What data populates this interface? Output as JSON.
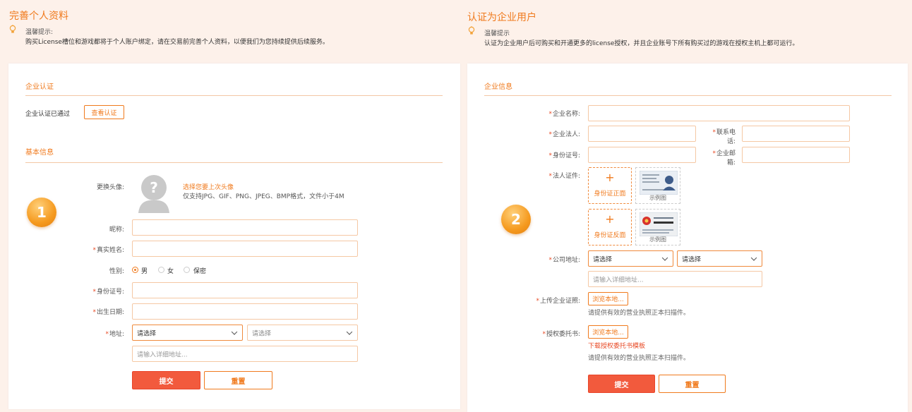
{
  "left": {
    "title": "完善个人资料",
    "tip_title": "温馨提示:",
    "tip_text": "购买License槽位和游戏都将于个人账户绑定，请在交易前完善个人资料，以便我们为您持续提供后续服务。",
    "enterprise_section": "企业认证",
    "enterprise_status": "企业认证已通过",
    "view_cert_button": "查看认证",
    "basic_section": "基本信息",
    "badge": "1",
    "avatar_label": "更换头像:",
    "avatar_select": "选择您要上次头像",
    "avatar_hint": "仅支持JPG、GIF、PNG、JPEG、BMP格式，文件小于4M",
    "nickname_label": "昵称:",
    "realname_label": "真实姓名:",
    "gender_label": "性别:",
    "gender_options": [
      "男",
      "女",
      "保密"
    ],
    "gender_selected": "男",
    "idno_label": "身份证号:",
    "birth_label": "出生日期:",
    "address_label": "地址:",
    "province_value": "请选择",
    "city_value": "请选择",
    "address_placeholder": "请输入详细地址...",
    "submit": "提交",
    "reset": "重置"
  },
  "right": {
    "title": "认证为企业用户",
    "tip_title": "温馨提示",
    "tip_text": "认证为企业用户后可购买和开通更多的license授权，并且企业账号下所有购买过的游戏在授权主机上都可运行。",
    "section": "企业信息",
    "badge": "2",
    "company_name_label": "企业名称:",
    "legal_person_label": "企业法人:",
    "phone_label": "联系电话:",
    "idno_label": "身份证号:",
    "email_label": "企业邮箱:",
    "id_doc_label": "法人证件:",
    "upload_front": "身份证正面",
    "upload_back": "身份证反面",
    "sample_caption": "示例图",
    "address_label": "公司地址:",
    "province_value": "请选择",
    "city_value": "请选择",
    "address_placeholder": "请输入详细地址...",
    "license_label": "上传企业证照:",
    "browse": "浏览本地...",
    "license_hint": "请提供有效的营业执照正本扫描件。",
    "authorization_label": "授权委托书:",
    "download_template": "下载授权委托书模板",
    "authorization_hint": "请提供有效的营业执照正本扫描件。",
    "submit": "提交",
    "reset": "重置"
  },
  "colors": {
    "accent": "#f07a1d",
    "submit_bg": "#f25a3d",
    "page_bg": "#fdf1ea",
    "required": "#e84a25"
  }
}
